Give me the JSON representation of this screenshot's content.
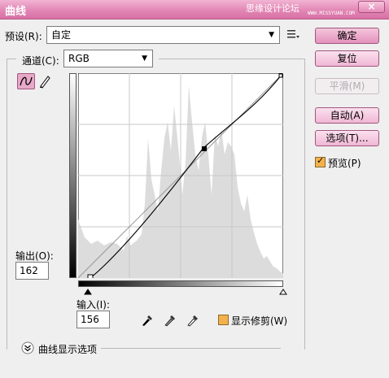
{
  "window": {
    "title": "曲线",
    "watermark": "思缘设计论坛",
    "watermark_sub": "WWW.MISSYUAN.COM",
    "close_label": "×"
  },
  "preset": {
    "label": "预设(R):",
    "value": "自定",
    "menu_icon": "list-menu-icon"
  },
  "channel": {
    "label": "通道(C):",
    "value": "RGB"
  },
  "buttons": {
    "ok": "确定",
    "reset": "复位",
    "smooth": "平滑(M)",
    "auto": "自动(A)",
    "options": "选项(T)..."
  },
  "preview": {
    "label": "预览(P)",
    "checked": true
  },
  "output": {
    "label": "输出(O):",
    "value": "162"
  },
  "input": {
    "label": "输入(I):",
    "value": "156"
  },
  "show_clipping": {
    "label": "显示修剪(W)",
    "checked": false
  },
  "curve_display_options": {
    "label": "曲线显示选项"
  },
  "curve": {
    "points": [
      [
        0,
        0
      ],
      [
        156,
        162
      ],
      [
        255,
        255
      ]
    ],
    "selected_point": [
      156,
      162
    ]
  },
  "colors": {
    "accent": "#e287b5",
    "histogram": "#dcdcdc",
    "grid": "#c8c8c8",
    "checkbox": "#f3b14c"
  }
}
